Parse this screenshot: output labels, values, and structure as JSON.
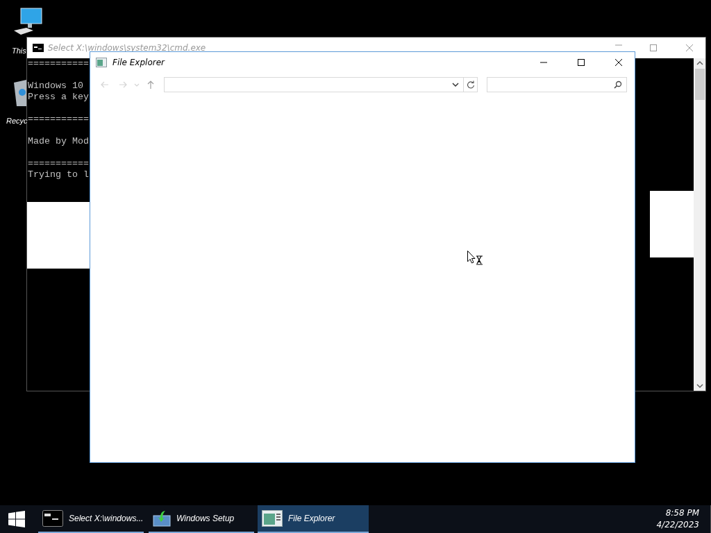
{
  "desktop_icons": [
    {
      "kind": "computer",
      "label": "This"
    },
    {
      "kind": "recycle",
      "label": "Recyc"
    }
  ],
  "console_window": {
    "title": "Select X:\\windows\\system32\\cmd.exe",
    "paragraphs": [
      [
        "==========="
      ],
      [
        "Windows 10",
        "Press a key"
      ],
      [
        "==========="
      ],
      [
        "Made by Mod"
      ],
      [
        "===========",
        "Trying to l"
      ]
    ]
  },
  "explorer_window": {
    "title": "File Explorer",
    "nav_buttons": [
      {
        "kind": "back",
        "disabled": true
      },
      {
        "kind": "forward",
        "disabled": true
      },
      {
        "kind": "recent",
        "disabled": true
      },
      {
        "kind": "up",
        "disabled": false
      }
    ]
  },
  "taskbar": {
    "items": [
      {
        "kind": "console",
        "label": "Select X:\\windows...",
        "selected": false
      },
      {
        "kind": "setup",
        "label": "Windows Setup",
        "selected": false
      },
      {
        "kind": "explorer",
        "label": "File Explorer",
        "selected": true
      }
    ],
    "clock": {
      "time": "8:58 PM",
      "date": "4/22/2023"
    }
  }
}
